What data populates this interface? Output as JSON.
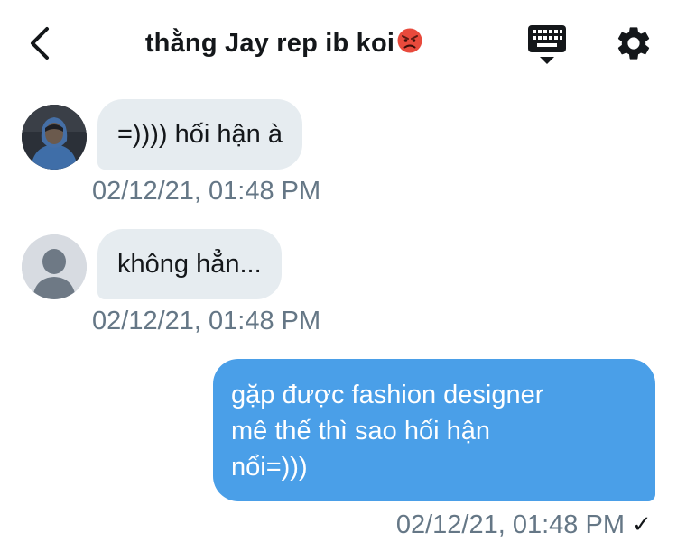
{
  "header": {
    "title": "thằng Jay rep ib koi",
    "back_icon": "chevron-left-icon",
    "keyboard_icon": "keyboard-icon",
    "settings_icon": "gear-icon"
  },
  "messages": [
    {
      "direction": "incoming",
      "avatar": "profile-photo",
      "text": "=)))) hối hận à",
      "timestamp": "02/12/21, 01:48 PM"
    },
    {
      "direction": "incoming",
      "avatar": "default-avatar",
      "text": "không hẳn...",
      "timestamp": "02/12/21, 01:48 PM"
    },
    {
      "direction": "outgoing",
      "lines": [
        "gặp được fashion designer",
        "mê thế thì sao hối hận",
        "nổi=)))"
      ],
      "timestamp": "02/12/21, 01:48 PM",
      "status": "✓"
    }
  ],
  "colors": {
    "incoming_bubble": "#e6ecf0",
    "outgoing_bubble": "#4a9fe8",
    "timestamp": "#657786"
  }
}
